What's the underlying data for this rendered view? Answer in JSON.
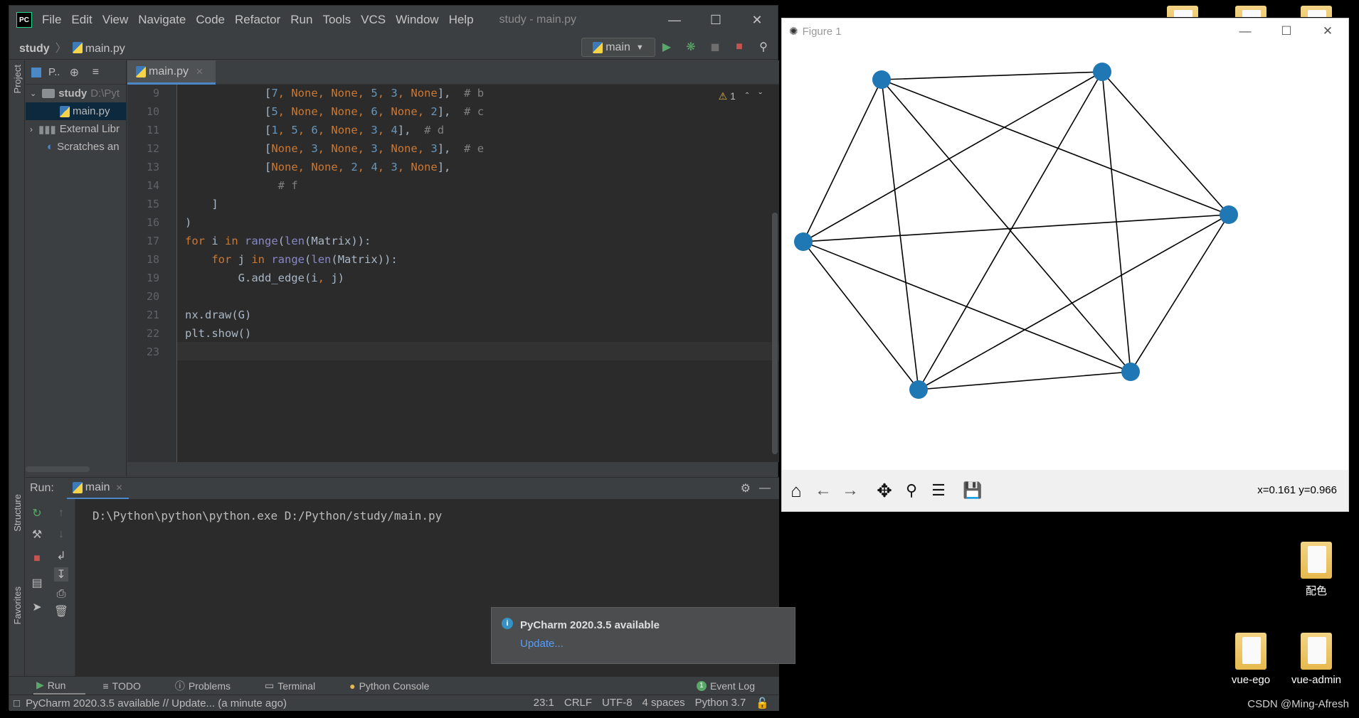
{
  "ide": {
    "menu": [
      "File",
      "Edit",
      "View",
      "Navigate",
      "Code",
      "Refactor",
      "Run",
      "Tools",
      "VCS",
      "Window",
      "Help"
    ],
    "window_title": "study - main.py",
    "breadcrumb": {
      "project": "study",
      "file": "main.py"
    },
    "run_config": "main",
    "project_panel": {
      "header": "P..",
      "items": [
        {
          "label": "study",
          "path": "D:\\Pyt"
        },
        {
          "label": "main.py"
        },
        {
          "label": "External Libr"
        },
        {
          "label": "Scratches an"
        }
      ]
    },
    "tab": "main.py",
    "warnings": "1",
    "code_lines": [
      {
        "n": "9"
      },
      {
        "n": "10"
      },
      {
        "n": "11"
      },
      {
        "n": "12"
      },
      {
        "n": "13"
      },
      {
        "n": "14"
      },
      {
        "n": "15"
      },
      {
        "n": "16"
      },
      {
        "n": "17"
      },
      {
        "n": "18"
      },
      {
        "n": "19"
      },
      {
        "n": "20"
      },
      {
        "n": "21"
      },
      {
        "n": "22"
      },
      {
        "n": "23"
      }
    ],
    "run_panel": {
      "label": "Run:",
      "tab": "main",
      "console": "D:\\Python\\python\\python.exe D:/Python/study/main.py"
    },
    "notification": {
      "title": "PyCharm 2020.3.5 available",
      "link": "Update..."
    },
    "tool_windows": [
      "Run",
      "TODO",
      "Problems",
      "Terminal",
      "Python Console"
    ],
    "event_log": "Event Log",
    "event_count": "1",
    "side_labels": {
      "project": "Project",
      "structure": "Structure",
      "favorites": "Favorites"
    },
    "status": {
      "message": "PyCharm 2020.3.5 available // Update... (a minute ago)",
      "position": "23:1",
      "line_sep": "CRLF",
      "encoding": "UTF-8",
      "indent": "4 spaces",
      "interpreter": "Python 3.7"
    }
  },
  "figure": {
    "title": "Figure 1",
    "coords": "x=0.161 y=0.966",
    "node_color": "#1f77b4"
  },
  "desktop": {
    "icons": [
      "配色",
      "vue-ego",
      "vue-admin"
    ],
    "watermark": "CSDN @Ming-Afresh"
  }
}
